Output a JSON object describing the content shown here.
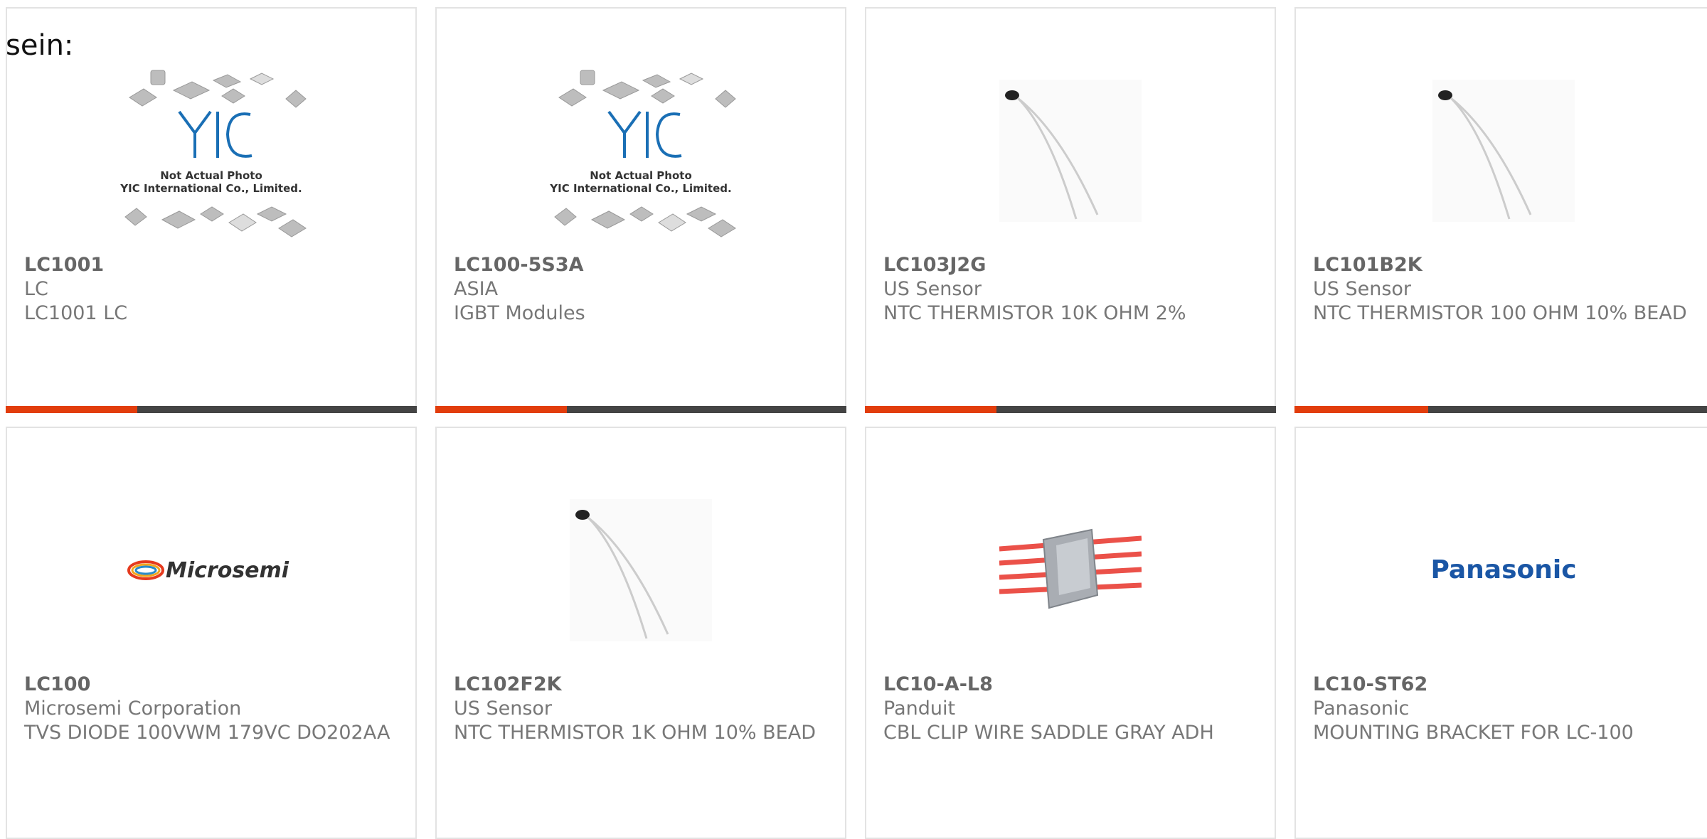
{
  "page": {
    "lead_text": "sein:"
  },
  "colors": {
    "accent": "#e23d0c",
    "bar_dark": "#444444",
    "card_border": "#e3e3e3",
    "text": "#666666"
  },
  "products": [
    {
      "part_number": "LC1001",
      "manufacturer": "LC",
      "description": "LC1001 LC",
      "image": "yic-placeholder-image",
      "image_text": {
        "line1": "Not Actual Photo",
        "line2": "YIC International Co., Limited.",
        "logo": "YIC"
      }
    },
    {
      "part_number": "LC100-5S3A",
      "manufacturer": "ASIA",
      "description": "IGBT Modules",
      "image": "yic-placeholder-image",
      "image_text": {
        "line1": "Not Actual Photo",
        "line2": "YIC International Co., Limited.",
        "logo": "YIC"
      }
    },
    {
      "part_number": "LC103J2G",
      "manufacturer": "US Sensor",
      "description": "NTC THERMISTOR 10K OHM 2%",
      "image": "thermistor-image"
    },
    {
      "part_number": "LC101B2K",
      "manufacturer": "US Sensor",
      "description": "NTC THERMISTOR 100 OHM 10% BEAD",
      "image": "thermistor-image"
    },
    {
      "part_number": "LC100",
      "manufacturer": "Microsemi Corporation",
      "description": "TVS DIODE 100VWM 179VC DO202AA",
      "image": "microsemi-logo",
      "image_text": {
        "logo": "Microsemi"
      }
    },
    {
      "part_number": "LC102F2K",
      "manufacturer": "US Sensor",
      "description": "NTC THERMISTOR 1K OHM 10% BEAD",
      "image": "thermistor-image"
    },
    {
      "part_number": "LC10-A-L8",
      "manufacturer": "Panduit",
      "description": "CBL CLIP WIRE SADDLE GRAY ADH",
      "image": "cable-clip-image"
    },
    {
      "part_number": "LC10-ST62",
      "manufacturer": "Panasonic",
      "description": "MOUNTING BRACKET FOR LC-100",
      "image": "panasonic-logo",
      "image_text": {
        "logo": "Panasonic"
      }
    }
  ]
}
